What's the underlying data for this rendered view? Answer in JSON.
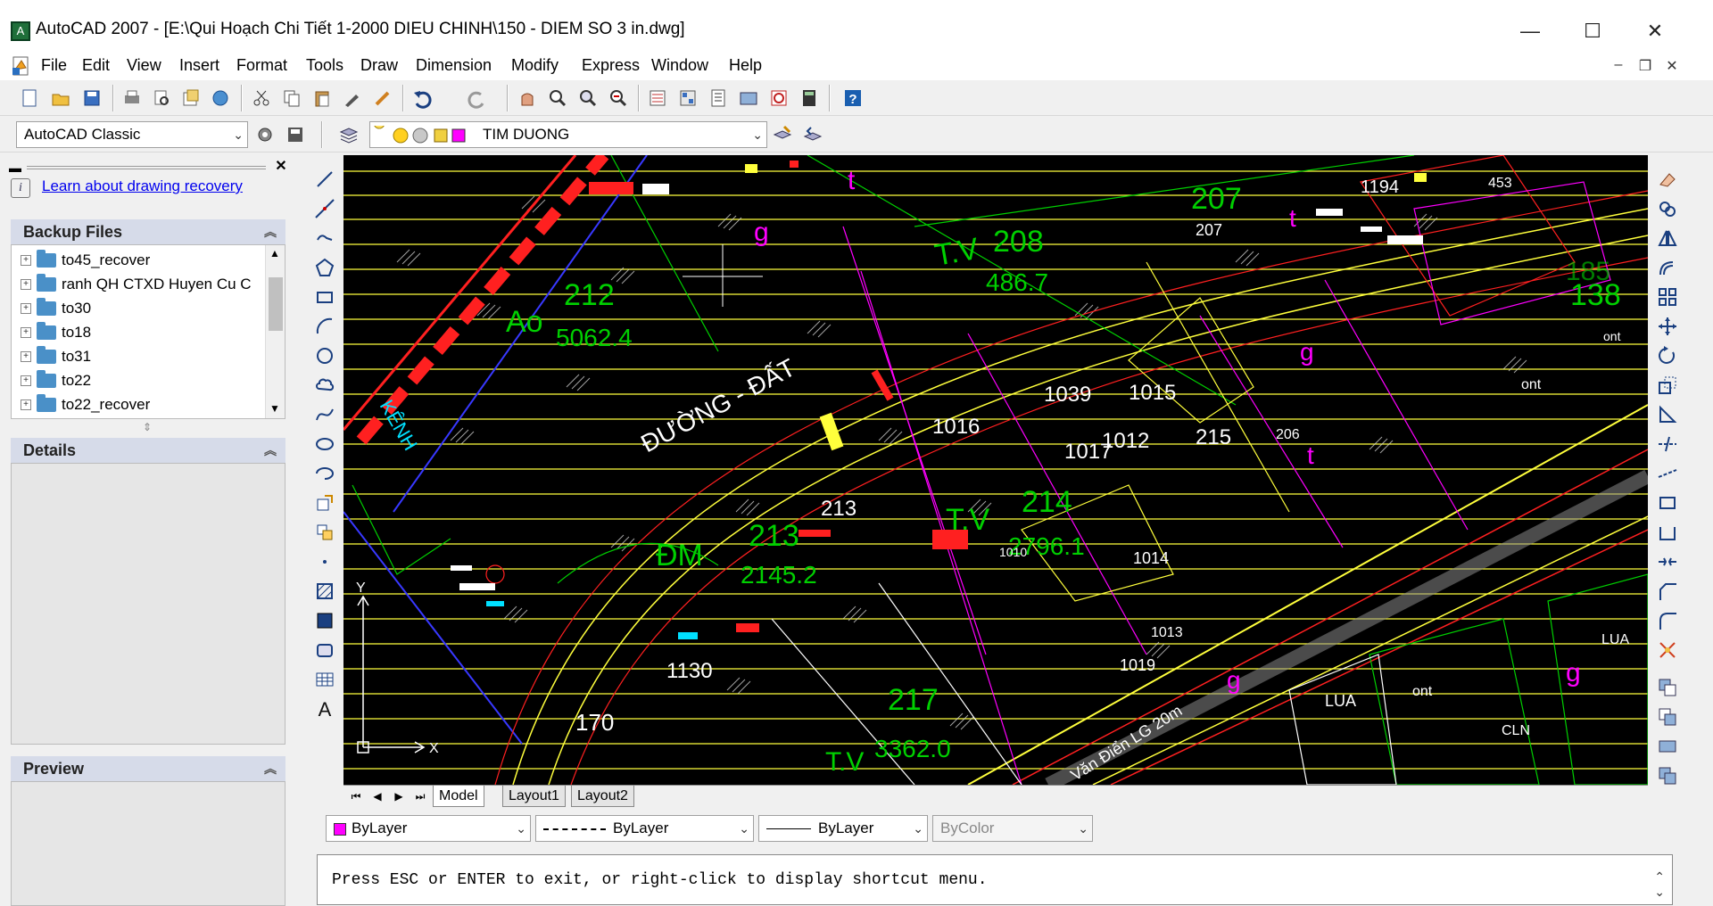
{
  "window": {
    "title": "AutoCAD 2007 - [E:\\Qui Hoạch Chi Tiết 1-2000 DIEU CHINH\\150 - DIEM SO 3 in.dwg]",
    "minimize_glyph": "—",
    "maximize_glyph": "☐",
    "close_glyph": "✕"
  },
  "menu": {
    "items": [
      "File",
      "Edit",
      "View",
      "Insert",
      "Format",
      "Tools",
      "Draw",
      "Dimension",
      "Modify",
      "Express",
      "Window",
      "Help"
    ],
    "mdi_min": "–",
    "mdi_restore": "❐",
    "mdi_close": "✕"
  },
  "toolbar2": {
    "workspace": "AutoCAD Classic",
    "layer": "TIM DUONG"
  },
  "recovery": {
    "link": "Learn about drawing recovery",
    "backup_header": "Backup Files",
    "files": [
      "to45_recover",
      "ranh QH CTXD Huyen Cu C",
      "to30",
      "to18",
      "to31",
      "to22",
      "to22_recover"
    ],
    "details_header": "Details",
    "preview_header": "Preview"
  },
  "layout_tabs": [
    "Model",
    "Layout1",
    "Layout2"
  ],
  "properties": {
    "color": "ByLayer",
    "linetype": "ByLayer",
    "lineweight": "ByLayer",
    "plotstyle": "ByColor"
  },
  "command_line": "Press ESC or ENTER to exit, or right-click to display shortcut menu.",
  "drawing": {
    "labels": {
      "ao": "Ao",
      "p212": "212",
      "a212": "5062.4",
      "tv208": "T.V",
      "p208": "208",
      "a208": "486.7",
      "p207": "207",
      "p207b": "207",
      "duong": "ĐƯỜNG - ĐẤT",
      "kenh": "KÊNH",
      "dm": "ĐM",
      "p213": "213",
      "a213": "2145.2",
      "p213b": "213",
      "p1130": "1130",
      "p170": "170",
      "p1016": "1016",
      "p1017": "1017",
      "p1015": "1015",
      "p1039": "1039",
      "p1012": "1012",
      "p215": "215",
      "p206": "206",
      "tv214": "T.V",
      "p214": "214",
      "a214": "2796.1",
      "p1010": "1010",
      "p1014": "1014",
      "p1013": "1013",
      "p1019": "1019",
      "p217": "217",
      "a217": "3362.0",
      "tv217": "T.V",
      "lua": "LUA",
      "lua2": "LUA",
      "ont": "ont",
      "ont2": "ont",
      "ont3": "ont",
      "cln": "CLN",
      "road": "Văn Điển LG 20m",
      "p138": "138",
      "p185": "185",
      "p1194": "1194",
      "p453": "453",
      "g": "g",
      "t": "t"
    }
  },
  "colors": {
    "canvas_bg": "#000000",
    "green": "#00d000",
    "yellow": "#ffff3c",
    "red": "#ff2020",
    "magenta": "#ff00ff",
    "white": "#ffffff",
    "cyan": "#00e0ff",
    "accent_link": "#0000ee",
    "panel_header": "#d6dbe9"
  },
  "icons": {
    "app": "autocad-icon",
    "folder": "folder-icon"
  }
}
